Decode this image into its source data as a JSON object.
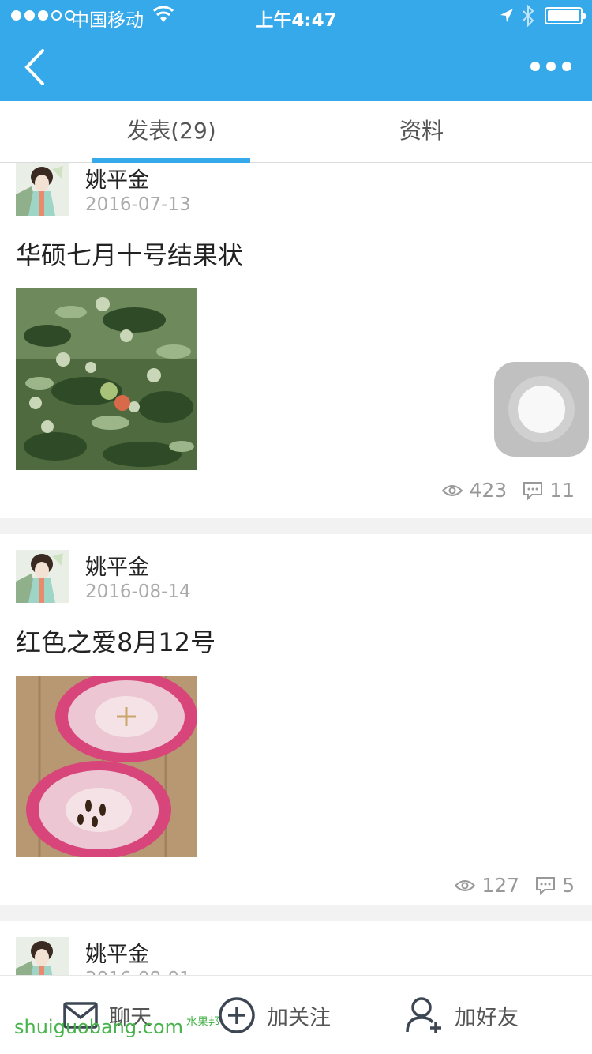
{
  "status_bar": {
    "carrier": "中国移动",
    "time": "上午4:47"
  },
  "tabs": [
    {
      "label": "发表(29)",
      "active": true
    },
    {
      "label": "资料",
      "active": false
    }
  ],
  "posts": [
    {
      "author": "姚平金",
      "date": "2016-07-13",
      "title": "华硕七月十号结果状",
      "views": "423",
      "comments": "11",
      "image": "apple-tree-photo"
    },
    {
      "author": "姚平金",
      "date": "2016-08-14",
      "title": "红色之爱8月12号",
      "views": "127",
      "comments": "5",
      "image": "cut-red-apple-photo"
    },
    {
      "author": "姚平金",
      "date": "2016-08-01"
    }
  ],
  "bottom_bar": {
    "chat_label": "聊天",
    "follow_label": "加关注",
    "add_friend_label": "加好友"
  },
  "watermark": {
    "text": "shuiguobang.com",
    "cn": "水果邦"
  },
  "colors": {
    "brand": "#36a9ea",
    "muted": "#999999"
  }
}
